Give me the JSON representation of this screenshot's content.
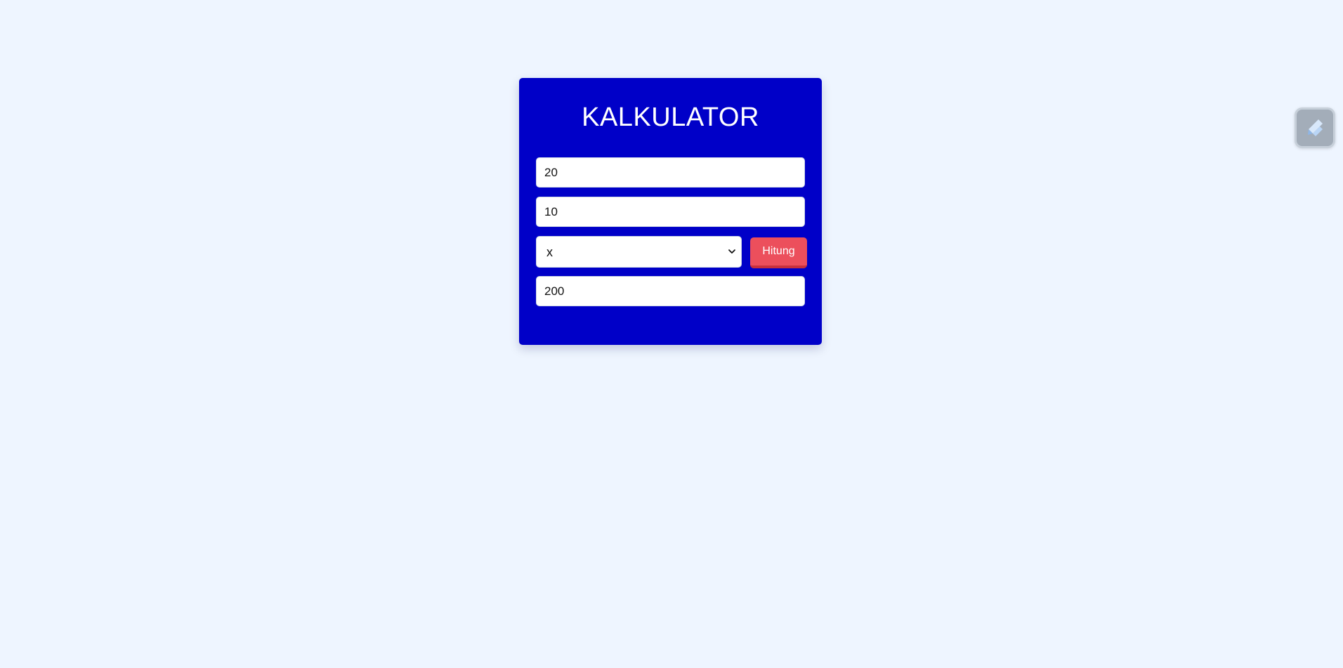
{
  "calculator": {
    "title": "KALKULATOR",
    "first_number": "20",
    "second_number": "10",
    "operator": {
      "selected": "x",
      "icon": "chevron-down-icon"
    },
    "calculate_label": "Hitung",
    "result": "200"
  },
  "floating_button": {
    "icon": "pen-icon"
  },
  "colors": {
    "background": "#eef5ff",
    "card": "#0000c8",
    "button": "#ec4f5c",
    "button_shadow": "#c7303e"
  }
}
